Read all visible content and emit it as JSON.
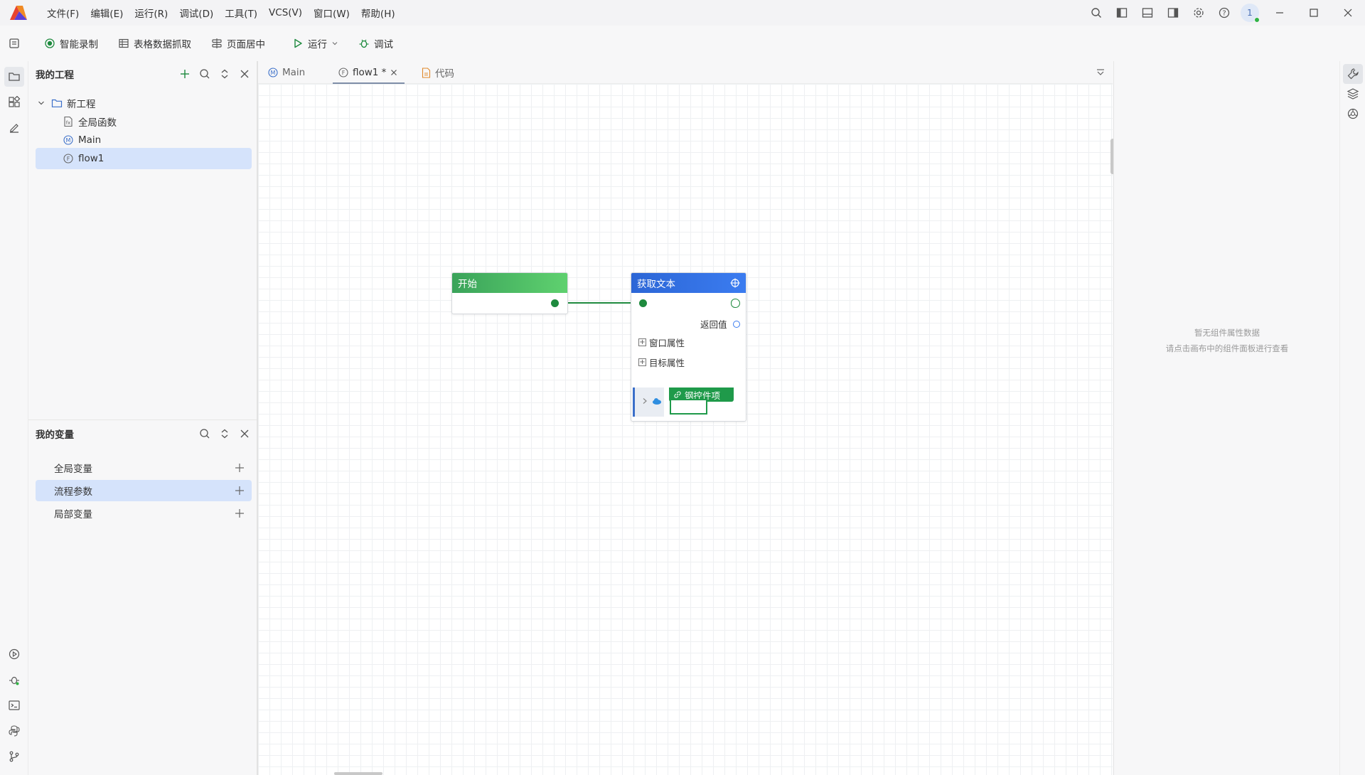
{
  "app": {
    "menu": [
      "文件(F)",
      "编辑(E)",
      "运行(R)",
      "调试(D)",
      "工具(T)",
      "VCS(V)",
      "窗口(W)",
      "帮助(H)"
    ],
    "user_initial": "1",
    "colors": {
      "accent": "#2c66d6",
      "start_node": "#4cc05f",
      "selection": "#d5e3fb",
      "connector": "#1e8a3e"
    }
  },
  "toolbar": {
    "smart_record": "智能录制",
    "table_capture": "表格数据抓取",
    "page_center": "页面居中",
    "run": "运行",
    "debug": "调试"
  },
  "project": {
    "title": "我的工程",
    "root": "新工程",
    "items": [
      {
        "label": "全局函数",
        "icon": "function-file-icon"
      },
      {
        "label": "Main",
        "icon": "main-flow-icon"
      },
      {
        "label": "flow1",
        "icon": "flow-icon",
        "selected": true
      }
    ]
  },
  "variables": {
    "title": "我的变量",
    "items": [
      {
        "label": "全局变量"
      },
      {
        "label": "流程参数",
        "selected": true
      },
      {
        "label": "局部变量"
      }
    ]
  },
  "tabs": [
    {
      "label": "Main",
      "icon": "main-flow-icon"
    },
    {
      "label": "flow1 *",
      "icon": "flow-icon",
      "active": true
    },
    {
      "label": "代码",
      "icon": "code-file-icon"
    }
  ],
  "canvas": {
    "start_node": {
      "title": "开始"
    },
    "get_text_node": {
      "title": "获取文本",
      "return_label": "返回值",
      "window_props": "窗口属性",
      "target_props": "目标属性",
      "drop_hint": "钢控件项"
    }
  },
  "properties": {
    "empty_line1": "暂无组件属性数据",
    "empty_line2": "请点击画布中的组件面板进行查看"
  }
}
